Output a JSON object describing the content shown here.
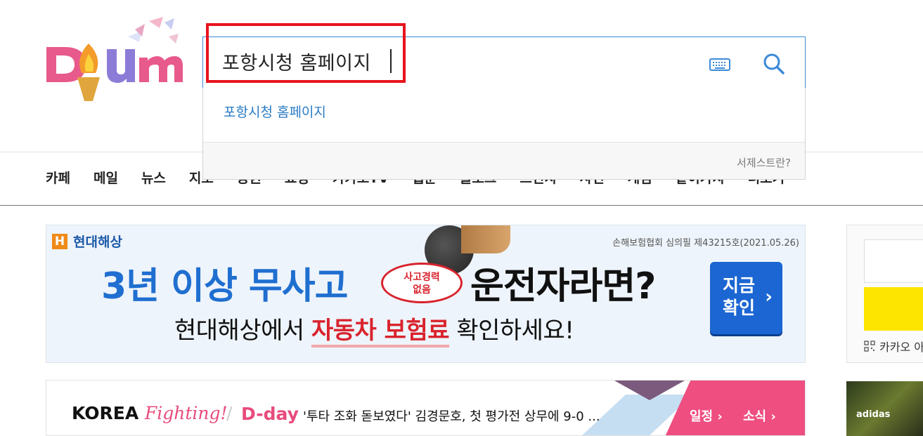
{
  "logo": {
    "alt": "Daum"
  },
  "search": {
    "query": "포항시청 홈페이지",
    "suggestions": [
      "포항시청 홈페이지"
    ],
    "help_link": "서제스트란?"
  },
  "nav": {
    "items": [
      "카페",
      "메일",
      "뉴스",
      "지도",
      "증권",
      "쇼핑",
      "카카오TV",
      "웹툰",
      "블로그",
      "브런치",
      "사전",
      "게임",
      "같이가치",
      "더보기"
    ]
  },
  "ad": {
    "brand": "현대해상",
    "brand_mark": "H",
    "note": "손해보험협회 심의필 제43215호(2021.05.26)",
    "headline_left": "3년 이상 무사고",
    "stamp_line1": "사고경력",
    "stamp_line2": "없음",
    "headline_right": "운전자라면?",
    "sub_pre": "현대해상에서 ",
    "sub_highlight": "자동차 보험료",
    "sub_post": " 확인하세요!",
    "cta_line1": "지금",
    "cta_line2": "확인",
    "cta_arrow": "›"
  },
  "right_panel": {
    "kakao_label": "카카오 아이디로"
  },
  "korea": {
    "brand": "KOREA ",
    "fighting": "Fighting!",
    "dday": "D-day",
    "headline": "'투타 조화 돋보였다' 김경문호, 첫 평가전 상무에 9-0 ...",
    "link_schedule": "일정 ›",
    "link_news": "소식 ›"
  },
  "right_photo": {
    "brand": "adidas"
  },
  "colors": {
    "accent_blue": "#3c8ad8",
    "suggest_blue": "#2a7bc5",
    "highlight_red": "#e8141c",
    "kakao_yellow": "#fee500",
    "korea_pink": "#ef4e81"
  }
}
